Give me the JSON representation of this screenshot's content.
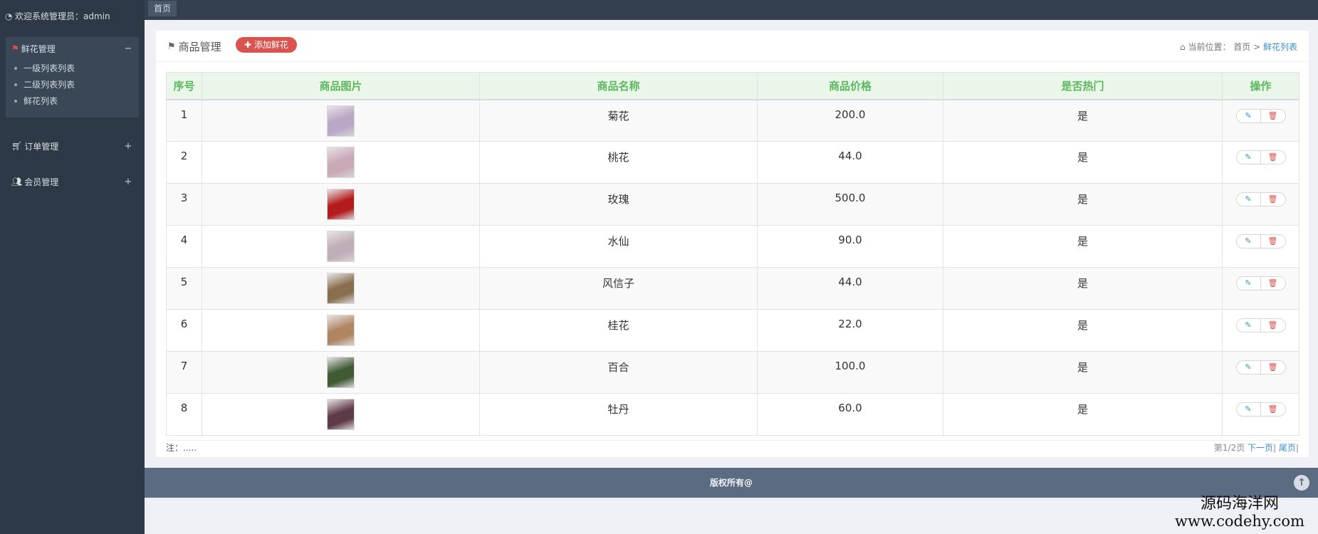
{
  "sidebar": {
    "welcome": "欢迎系统管理员：admin",
    "groups": [
      {
        "label": "鲜花管理",
        "toggle": "−",
        "items": [
          "一级列表列表",
          "二级列表列表",
          "鲜花列表"
        ]
      },
      {
        "label": "订单管理",
        "toggle": "+"
      },
      {
        "label": "会员管理",
        "toggle": "+"
      }
    ]
  },
  "topbar": {
    "home_tab": "首页"
  },
  "panel": {
    "title": "商品管理",
    "add_button": "添加鲜花",
    "breadcrumb": {
      "prefix": "当前位置：",
      "home": "首页",
      "sep": " > ",
      "current": "鲜花列表"
    }
  },
  "table": {
    "headers": [
      "序号",
      "商品图片",
      "商品名称",
      "商品价格",
      "是否热门",
      "操作"
    ],
    "rows": [
      {
        "id": "1",
        "name": "菊花",
        "price": "200.0",
        "hot": "是",
        "img_color": "#b9a7c6"
      },
      {
        "id": "2",
        "name": "桃花",
        "price": "44.0",
        "hot": "是",
        "img_color": "#c9a9b8"
      },
      {
        "id": "3",
        "name": "玫瑰",
        "price": "500.0",
        "hot": "是",
        "img_color": "#b31c1c"
      },
      {
        "id": "4",
        "name": "水仙",
        "price": "90.0",
        "hot": "是",
        "img_color": "#bfaeb8"
      },
      {
        "id": "5",
        "name": "风信子",
        "price": "44.0",
        "hot": "是",
        "img_color": "#8a6f4e"
      },
      {
        "id": "6",
        "name": "桂花",
        "price": "22.0",
        "hot": "是",
        "img_color": "#b08662"
      },
      {
        "id": "7",
        "name": "百合",
        "price": "100.0",
        "hot": "是",
        "img_color": "#3f5a34"
      },
      {
        "id": "8",
        "name": "牡丹",
        "price": "60.0",
        "hot": "是",
        "img_color": "#5e3b4a"
      }
    ]
  },
  "note": "注：.....",
  "pager": {
    "info": "第1/2页 ",
    "next": "下一页",
    "sep": "|",
    "last": "尾页",
    "end": "|"
  },
  "footer": {
    "copyright": "版权所有@"
  },
  "watermark": {
    "cn": "源码海洋网",
    "url": "www.codehy.com"
  }
}
